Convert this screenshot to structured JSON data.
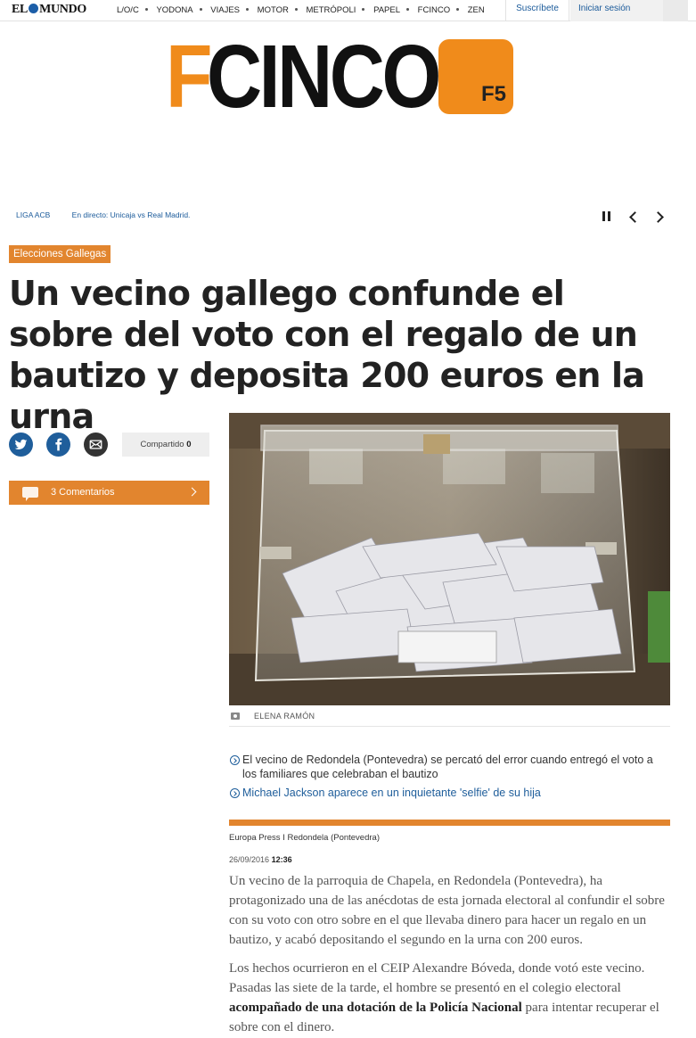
{
  "topbar": {
    "logo_left": "EL",
    "logo_right": "MUNDO",
    "nav": [
      "L/O/C",
      "YODONA",
      "VIAJES",
      "MOTOR",
      "METRÓPOLI",
      "PAPEL",
      "FCINCO",
      "ZEN"
    ],
    "subscribe": "Suscríbete",
    "login": "Iniciar sesión"
  },
  "brand": {
    "f": "F",
    "cinco": "CINCO",
    "badge": "F5",
    "accent": "#f08b1b"
  },
  "ticker": {
    "tag": "LIGA ACB",
    "headline": "En directo: Unicaja vs Real Madrid."
  },
  "article": {
    "section": "Elecciones Gallegas",
    "headline": "Un vecino gallego confunde el sobre del voto con el regalo de un bautizo y deposita 200 euros en la urna",
    "shared_label": "Compartido",
    "shared_count": "0",
    "comments": "3 Comentarios",
    "photo_credit": "ELENA RAMÓN",
    "related": [
      "El vecino de Redondela (Pontevedra) se percató del error cuando entregó el voto a los familiares que celebraban el bautizo",
      "Michael Jackson aparece en un inquietante 'selfie' de su hija"
    ],
    "byline": "Europa Press I Redondela (Pontevedra)",
    "date": "26/09/2016",
    "time": "12:36",
    "p1": "Un vecino de la parroquia de Chapela, en Redondela (Pontevedra), ha protagonizado una de las anécdotas de esta jornada electoral al confundir el sobre con su voto con otro sobre en el que llevaba dinero para hacer un regalo en un bautizo, y acabó depositando el segundo en la urna con 200 euros.",
    "p2_start": "Los hechos ocurrieron en el CEIP Alexandre Bóveda, donde votó este vecino. Pasadas las siete de la tarde, el hombre se presentó en el colegio electoral ",
    "p2_bold": "acompañado de una dotación de la Policía Nacional",
    "p2_end": " para intentar recuperar el sobre con el dinero."
  },
  "colors": {
    "orange": "#e2852e",
    "link_blue": "#1f5e9b"
  }
}
